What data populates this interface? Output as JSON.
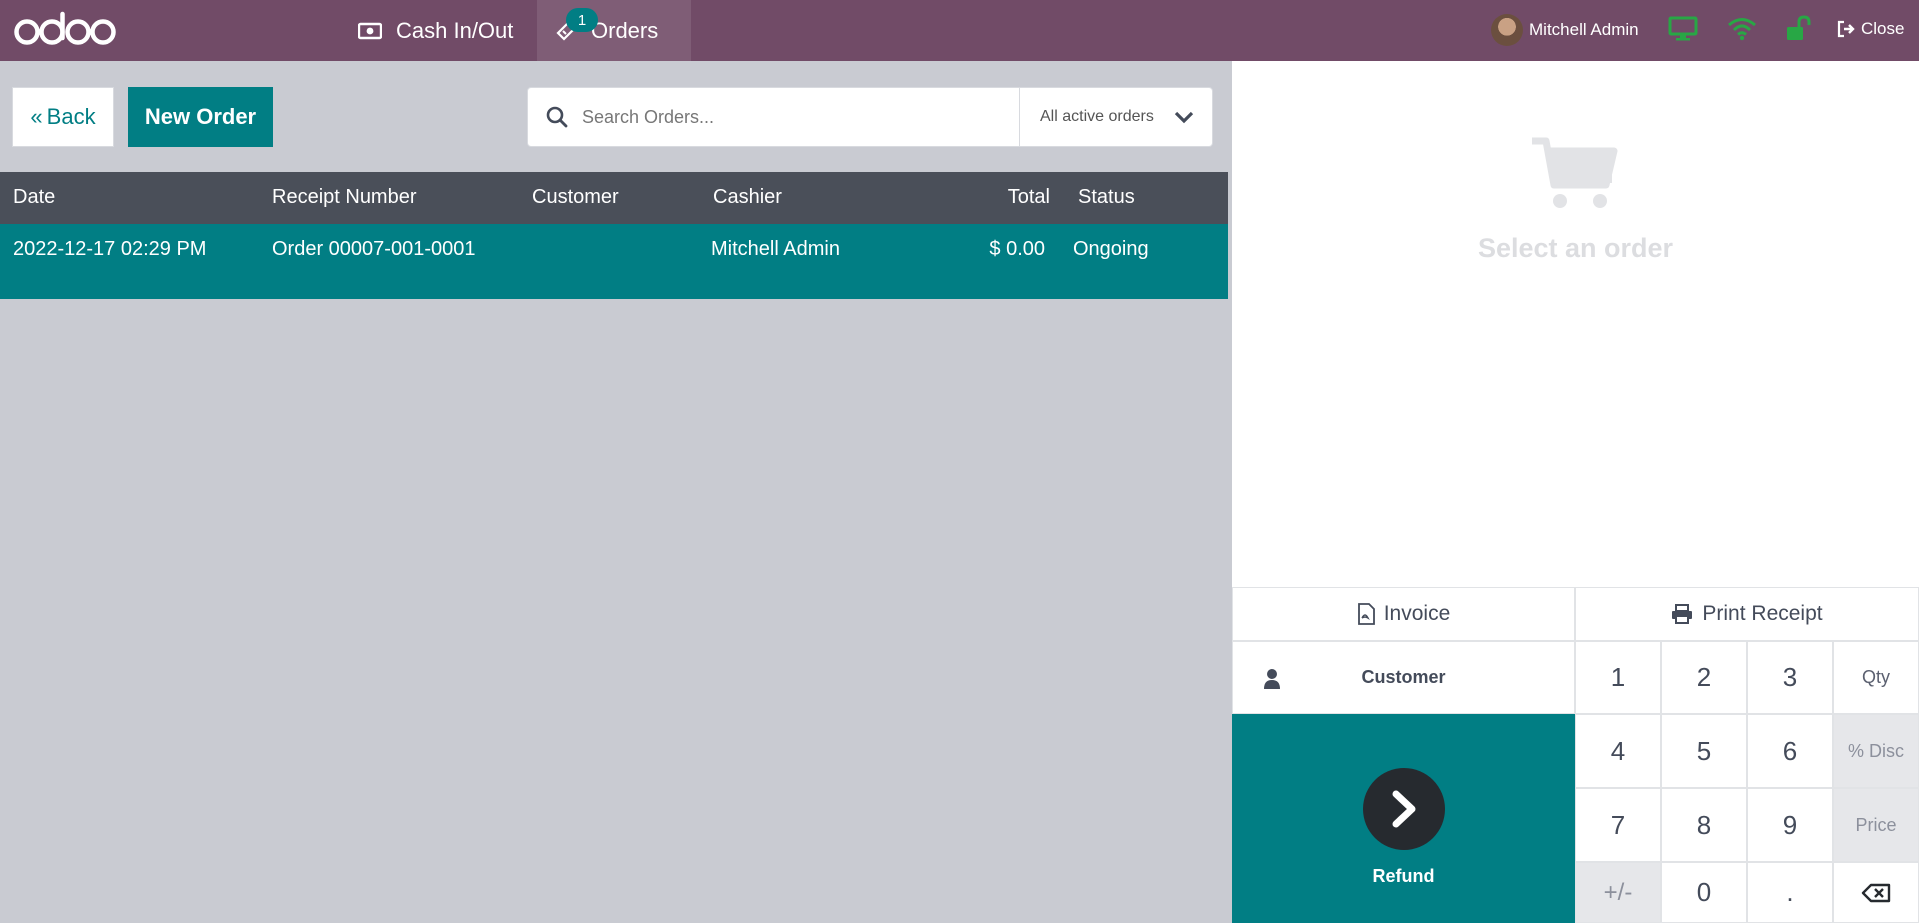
{
  "topbar": {
    "logo_text": "odoo",
    "cash_label": "Cash In/Out",
    "orders_label": "Orders",
    "orders_badge": "1",
    "user_name": "Mitchell Admin",
    "close_label": "Close",
    "colors": {
      "bar": "#714b67",
      "status_green": "#28a745",
      "badge": "#017e84"
    }
  },
  "toolbar": {
    "back_label": "Back",
    "new_order_label": "New Order",
    "search_placeholder": "Search Orders...",
    "filter_value": "All active orders"
  },
  "table": {
    "headers": {
      "date": "Date",
      "receipt": "Receipt Number",
      "customer": "Customer",
      "cashier": "Cashier",
      "total": "Total",
      "status": "Status"
    },
    "rows": [
      {
        "date": "2022-12-17 02:29 PM",
        "receipt": "Order 00007-001-0001",
        "customer": "",
        "cashier": "Mitchell Admin",
        "total": "$ 0.00",
        "status": "Ongoing"
      }
    ]
  },
  "detail": {
    "empty_text": "Select an order"
  },
  "controls": {
    "invoice_label": "Invoice",
    "print_label": "Print Receipt",
    "customer_label": "Customer",
    "refund_label": "Refund",
    "keys": {
      "k1": "1",
      "k2": "2",
      "k3": "3",
      "qty": "Qty",
      "k4": "4",
      "k5": "5",
      "k6": "6",
      "disc": "% Disc",
      "k7": "7",
      "k8": "8",
      "k9": "9",
      "price": "Price",
      "sign": "+/-",
      "k0": "0",
      "dot": "."
    }
  }
}
